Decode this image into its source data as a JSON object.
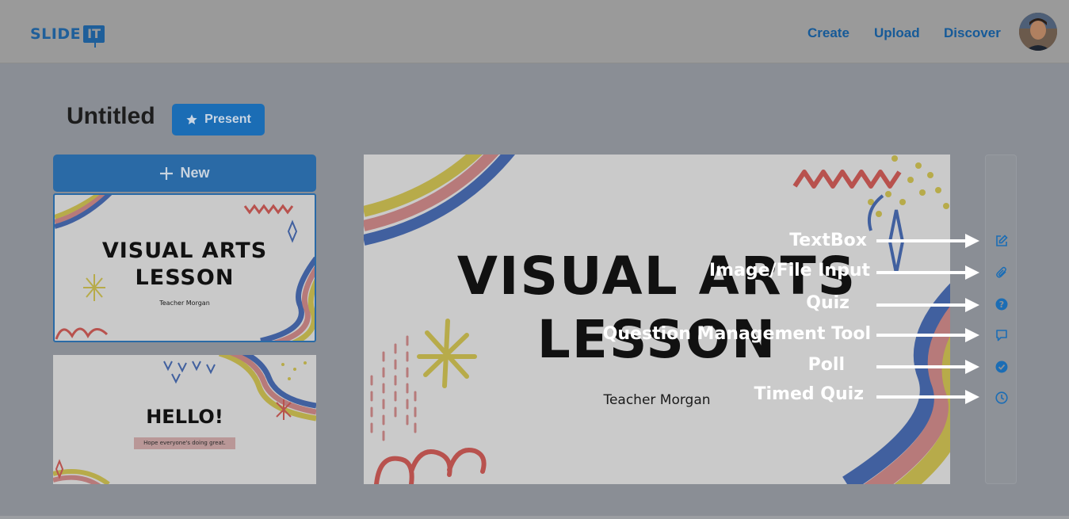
{
  "header": {
    "logo_text": "SLIDE",
    "logo_badge": "IT",
    "nav": [
      "Create",
      "Upload",
      "Discover"
    ]
  },
  "document": {
    "title": "Untitled",
    "present_label": "Present"
  },
  "sidebar": {
    "new_label": "New",
    "slides": [
      {
        "title_line1": "VISUAL ARTS",
        "title_line2": "LESSON",
        "subtitle": "Teacher Morgan"
      },
      {
        "title": "HELLO!",
        "subtitle": "Hope everyone's doing great."
      }
    ]
  },
  "slide": {
    "title_line1": "VISUAL ARTS",
    "title_line2": "LESSON",
    "subtitle": "Teacher Morgan"
  },
  "toolbar": {
    "tools": [
      {
        "name": "TextBox",
        "icon": "edit-icon"
      },
      {
        "name": "Image/File Input",
        "icon": "paperclip-icon"
      },
      {
        "name": "Quiz",
        "icon": "question-circle-icon"
      },
      {
        "name": "Question Management Tool",
        "icon": "speech-bubble-icon"
      },
      {
        "name": "Poll",
        "icon": "check-circle-icon"
      },
      {
        "name": "Timed Quiz",
        "icon": "clock-icon"
      }
    ]
  },
  "colors": {
    "accent": "#1b6db5",
    "overlay": "#8a8e95",
    "art_yellow": "#b7ab4a",
    "art_pink": "#b77a7a",
    "art_blue": "#41609f",
    "art_red": "#b8524e"
  }
}
